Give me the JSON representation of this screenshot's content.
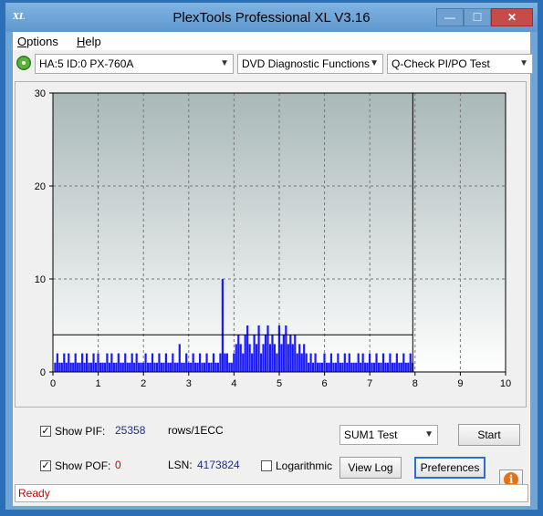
{
  "window": {
    "title": "PlexTools Professional XL V3.16",
    "icon_text": "XL",
    "controls": {
      "minimize": "—",
      "maximize": "☐",
      "close": "✕"
    }
  },
  "menu": [
    {
      "label": "Options",
      "mnemonic": "O",
      "rest": "ptions"
    },
    {
      "label": "Help",
      "mnemonic": "H",
      "rest": "elp"
    }
  ],
  "toolbar": {
    "drive_icon": "disc-drive-icon",
    "drive": "HA:5 ID:0  PX-760A",
    "function": "DVD Diagnostic Functions",
    "test": "Q-Check PI/PO Test",
    "dropdown_glyph": "▼"
  },
  "chart_data": {
    "type": "bar",
    "title": "",
    "xlabel": "",
    "ylabel": "",
    "xlim": [
      0,
      10
    ],
    "ylim": [
      0,
      30
    ],
    "x_ticks": [
      "0",
      "1",
      "2",
      "3",
      "4",
      "5",
      "6",
      "7",
      "8",
      "9",
      "10"
    ],
    "y_ticks": [
      "0",
      "10",
      "20",
      "30"
    ],
    "threshold_line": 4,
    "end_marker_x": 7.95,
    "grid": true,
    "series": [
      {
        "color": "#1a1aff",
        "x_start": 0.05,
        "x_step": 0.05,
        "values": [
          1,
          2,
          1,
          1,
          2,
          1,
          2,
          1,
          1,
          2,
          1,
          1,
          2,
          1,
          2,
          1,
          1,
          2,
          1,
          2,
          1,
          1,
          1,
          2,
          1,
          2,
          1,
          1,
          2,
          1,
          1,
          2,
          1,
          1,
          2,
          1,
          2,
          1,
          1,
          1,
          2,
          1,
          1,
          2,
          1,
          1,
          2,
          1,
          1,
          2,
          1,
          1,
          2,
          1,
          1,
          3,
          1,
          1,
          2,
          1,
          1,
          2,
          1,
          1,
          2,
          1,
          1,
          2,
          1,
          1,
          2,
          1,
          1,
          2,
          10,
          2,
          2,
          1,
          1,
          2,
          3,
          4,
          3,
          2,
          4,
          5,
          3,
          2,
          4,
          3,
          5,
          2,
          3,
          4,
          5,
          3,
          4,
          3,
          2,
          5,
          3,
          4,
          5,
          3,
          4,
          3,
          4,
          2,
          3,
          2,
          3,
          2,
          1,
          2,
          1,
          2,
          1,
          1,
          1,
          2,
          1,
          1,
          2,
          1,
          1,
          2,
          1,
          1,
          2,
          1,
          2,
          1,
          1,
          1,
          2,
          1,
          2,
          1,
          1,
          2,
          1,
          1,
          2,
          1,
          1,
          2,
          1,
          1,
          2,
          1,
          1,
          2,
          1,
          1,
          2,
          1,
          1,
          2,
          1
        ]
      }
    ]
  },
  "controls": {
    "show_pif_label": "Show PIF:",
    "pif_value": "25358",
    "rows_label": "rows/1ECC",
    "show_pof_label": "Show POF:",
    "pof_value": "0",
    "lsn_label": "LSN:",
    "lsn_value": "4173824",
    "logarithmic_label": "Logarithmic",
    "sum_select": "SUM1 Test",
    "start_button": "Start",
    "view_log_button": "View Log",
    "preferences_button": "Preferences",
    "info_glyph": "i"
  },
  "status": {
    "text": "Ready"
  }
}
